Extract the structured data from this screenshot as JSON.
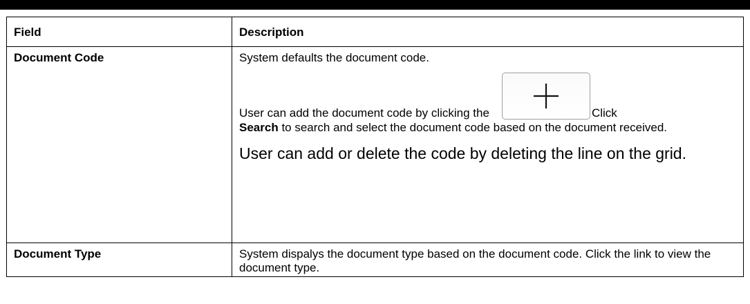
{
  "table": {
    "headers": [
      "Field",
      "Description"
    ],
    "rows": [
      {
        "field": "Document Code",
        "desc1": "System defaults the document code.",
        "desc2_before_icon": "User can add the document code by clicking the",
        "desc2_after_icon": "Click",
        "desc2_bold": "Search",
        "desc2_rest": "to search and select the document code based on the document received.",
        "desc3": "User can add or delete the code by deleting the line on the grid."
      },
      {
        "field": "Document Type",
        "desc1": "System dispalys the document type based on the document code. Click the link to view the document type."
      }
    ]
  },
  "icons": {
    "add_icon": "plus-icon"
  }
}
